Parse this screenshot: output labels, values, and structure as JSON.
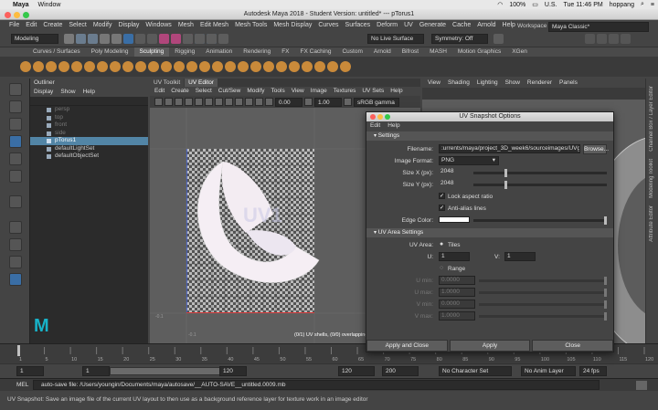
{
  "mac_menubar": {
    "apple": "",
    "items": [
      "Maya",
      "Window"
    ],
    "battery": "100%",
    "locale": "U.S.",
    "clock": "Tue 11:46 PM",
    "user": "hoppang"
  },
  "window_title": "Autodesk Maya 2018 - Student Version: untitled*   ---   pTorus1",
  "main_menu": [
    "File",
    "Edit",
    "Create",
    "Select",
    "Modify",
    "Display",
    "Windows",
    "Mesh",
    "Edit Mesh",
    "Mesh Tools",
    "Mesh Display",
    "Curves",
    "Surfaces",
    "Deform",
    "UV",
    "Generate",
    "Cache",
    "Arnold",
    "Help"
  ],
  "status_line": {
    "mode": "Modeling",
    "live_surface": "No Live Surface",
    "symmetry": "Symmetry: Off",
    "workspace_label": "Workspace :",
    "workspace": "Maya Classic*"
  },
  "shelf_tabs": [
    "Curves / Surfaces",
    "Poly Modeling",
    "Sculpting",
    "Rigging",
    "Animation",
    "Rendering",
    "FX",
    "FX Caching",
    "Custom",
    "Arnold",
    "Bifrost",
    "MASH",
    "Motion Graphics",
    "XGen"
  ],
  "shelf_active": "Sculpting",
  "outliner": {
    "title": "Outliner",
    "menu": [
      "Display",
      "Show",
      "Help"
    ],
    "items": [
      {
        "label": "persp",
        "dim": true
      },
      {
        "label": "top",
        "dim": true
      },
      {
        "label": "front",
        "dim": true
      },
      {
        "label": "side",
        "dim": true
      },
      {
        "label": "pTorus1",
        "sel": true
      },
      {
        "label": "defaultLightSet"
      },
      {
        "label": "defaultObjectSet"
      }
    ]
  },
  "uv_editor": {
    "tabs": [
      "UV Toolkit",
      "UV Editor"
    ],
    "menu": [
      "Edit",
      "Create",
      "Select",
      "Cut/Sew",
      "Modify",
      "Tools",
      "View",
      "Image",
      "Textures",
      "UV Sets",
      "Help"
    ],
    "field1": "0.00",
    "field2": "1.00",
    "colorspace": "sRGB gamma",
    "texture_label": "UV1",
    "status": "(0/1) UV shells, (0/0) overlapping",
    "tick_left": "-0.1",
    "tick_mid": "-0.1"
  },
  "viewport": {
    "menu": [
      "View",
      "Shading",
      "Lighting",
      "Show",
      "Renderer",
      "Panels"
    ]
  },
  "side_tabs": [
    "Channel Box / Layer Editor",
    "Modeling Toolkit",
    "Attribute Editor"
  ],
  "dialog": {
    "title": "UV Snapshot Options",
    "menu": [
      "Edit",
      "Help"
    ],
    "settings": "Settings",
    "filename_label": "Filename:",
    "filename": ":urrents/maya/project_3D_week6/sourceimages/UVguide",
    "browse": "Browse...",
    "format_label": "Image Format:",
    "format": "PNG",
    "sizex_label": "Size X (px):",
    "sizex": "2048",
    "sizey_label": "Size Y (px):",
    "sizey": "2048",
    "lock_label": "Lock aspect ratio",
    "aa_label": "Anti-alias lines",
    "edge_label": "Edge Color:",
    "uvarea": "UV Area Settings",
    "uvarea_label": "UV Area:",
    "tiles": "Tiles",
    "u_label": "U:",
    "u": "1",
    "v_label": "V:",
    "v": "1",
    "range": "Range",
    "umin_label": "U min:",
    "umin": "0.0000",
    "umax_label": "U max:",
    "umax": "1.0000",
    "vmin_label": "V min:",
    "vmin": "0.0000",
    "vmax_label": "V max:",
    "vmax": "1.0000",
    "apply_close": "Apply and Close",
    "apply": "Apply",
    "close": "Close"
  },
  "timeline": {
    "ticks": [
      "1",
      "5",
      "10",
      "15",
      "20",
      "25",
      "30",
      "35",
      "40",
      "45",
      "50",
      "55",
      "60",
      "65",
      "70",
      "75",
      "80",
      "85",
      "90",
      "95",
      "100",
      "105",
      "110",
      "115",
      "120"
    ],
    "current": "1"
  },
  "range_slider": {
    "start": "1",
    "inner_start": "1",
    "inner_end": "120",
    "end": "120",
    "anim_end": "200",
    "character_set": "No Character Set",
    "anim_layer": "No Anim Layer",
    "fps": "24 fps"
  },
  "command_line": {
    "lang": "MEL",
    "message": "auto-save file: /Users/youngin/Documents/maya/autosave/__AUTO-SAVE__untitled.0009.mb"
  },
  "help_line": "UV Snapshot: Save an image file of the current UV layout to then use as a background reference layer for texture work in an image editor"
}
